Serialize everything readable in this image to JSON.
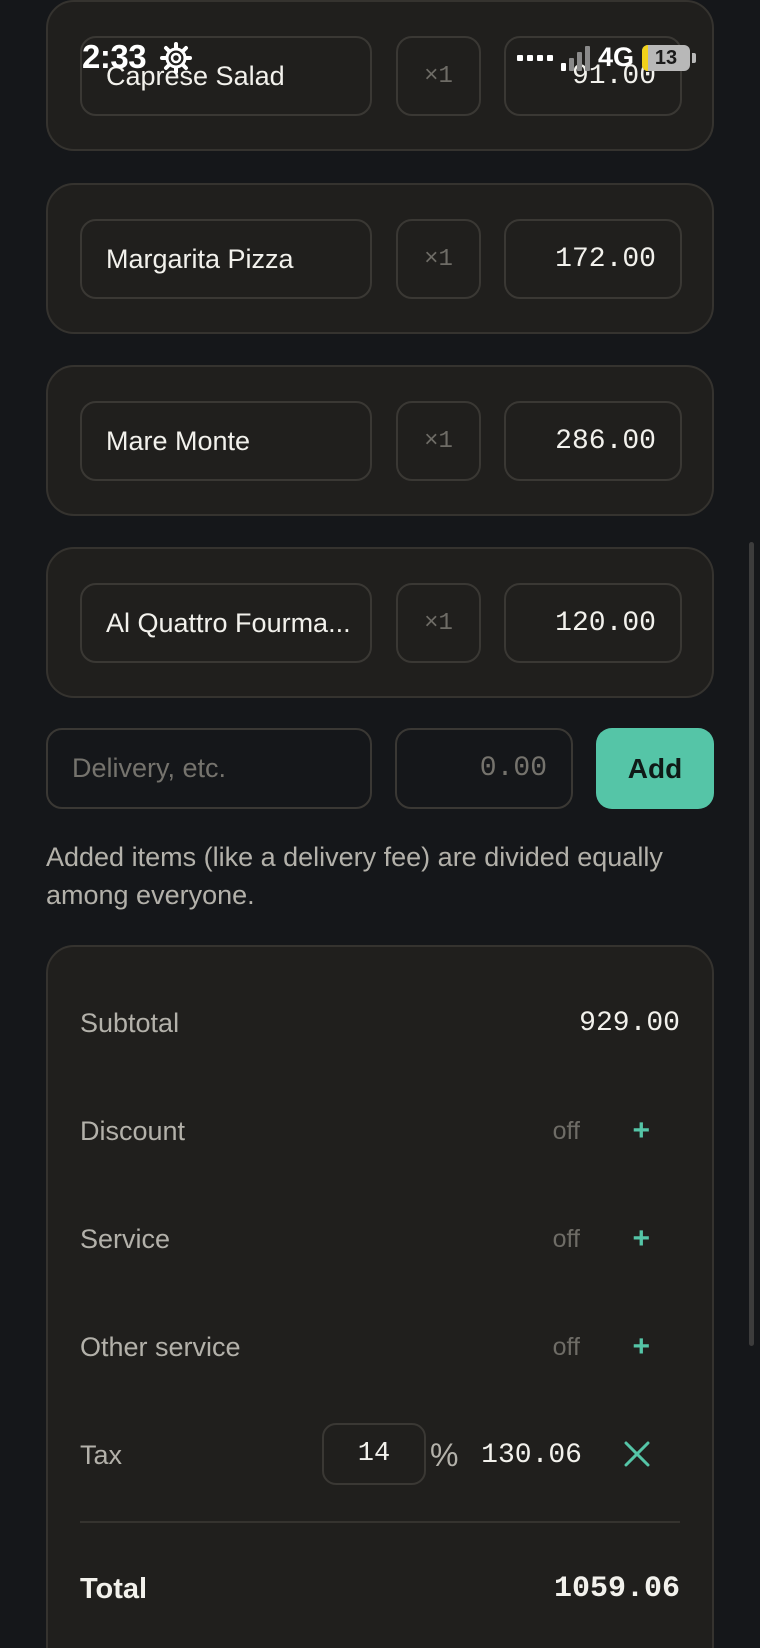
{
  "status_bar": {
    "time": "2:33",
    "network": "4G",
    "battery": "13",
    "battery_level": 0.13,
    "icons": [
      "gear-icon",
      "dots-icon",
      "signal-icon",
      "battery-icon"
    ]
  },
  "items": [
    {
      "name": "Caprese Salad",
      "qty": "×1",
      "price": "91.00"
    },
    {
      "name": "Margarita Pizza",
      "qty": "×1",
      "price": "172.00"
    },
    {
      "name": "Mare Monte",
      "qty": "×1",
      "price": "286.00"
    },
    {
      "name": "Al Quattro Fourma...",
      "qty": "×1",
      "price": "120.00"
    }
  ],
  "add_row": {
    "name_placeholder": "Delivery, etc.",
    "price_placeholder": "0.00",
    "add_label": "Add"
  },
  "hint": "Added items (like a delivery fee) are divided equally among everyone.",
  "summary": {
    "subtotal_label": "Subtotal",
    "subtotal_value": "929.00",
    "discount_label": "Discount",
    "discount_state": "off",
    "service_label": "Service",
    "service_state": "off",
    "other_service_label": "Other service",
    "other_service_state": "off",
    "plus_symbol": "+",
    "tax_label": "Tax",
    "tax_rate": "14",
    "tax_percent_symbol": "%",
    "tax_amount": "130.06",
    "total_label": "Total",
    "total_value": "1059.06"
  },
  "colors": {
    "accent": "#55c5a7",
    "background": "#15171a",
    "card": "#201f1d"
  }
}
